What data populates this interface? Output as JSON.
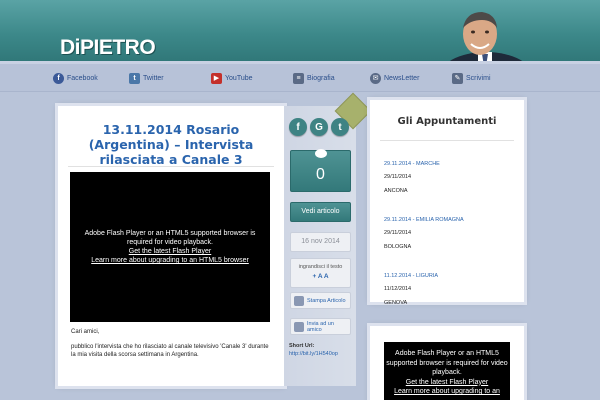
{
  "header": {
    "logo_text": "DiPIETRO"
  },
  "nav": {
    "items": [
      {
        "label": "Facebook",
        "icon": "facebook-icon",
        "color": "#3b5998"
      },
      {
        "label": "Twitter",
        "icon": "twitter-icon",
        "color": "#4a77a8"
      },
      {
        "label": "YouTube",
        "icon": "youtube-icon",
        "color": "#c4302b"
      },
      {
        "label": "Biografia",
        "icon": "biography-icon",
        "color": "#5a6a86"
      },
      {
        "label": "NewsLetter",
        "icon": "newsletter-icon",
        "color": "#5a6a86"
      },
      {
        "label": "Scrivimi",
        "icon": "pencil-icon",
        "color": "#5a6a86"
      }
    ]
  },
  "article": {
    "title": "13.11.2014 Rosario (Argentina) – Intervista rilasciata a Canale 3",
    "video": {
      "line1": "Adobe Flash Player or an HTML5 supported browser is required for video playback.",
      "link1": "Get the latest Flash Player",
      "link2": "Learn more about upgrading to an HTML5 browser"
    },
    "greeting": "Cari amici,",
    "body": "pubblico l'intervista che ho rilasciato al canale televisivo 'Canale 3' durante la mia visita della scorsa settimana in Argentina."
  },
  "tools": {
    "share": {
      "facebook": "f",
      "google": "G",
      "twitter": "t"
    },
    "comments_count": "0",
    "view_article": "Vedi articolo",
    "date": "16 nov 2014",
    "font_size_label": "ingrandisci il testo",
    "font_size_controls": "+ A A",
    "print_label": "Stampa Articolo",
    "send_label": "Invia ad un amico",
    "short_url_label": "Short Url:",
    "short_url": "http://bit.ly/1H540op"
  },
  "appointments": {
    "title": "Gli Appuntamenti",
    "items": [
      {
        "head": "29.11.2014 - MARCHE",
        "date": "29/11/2014",
        "city": "ANCONA"
      },
      {
        "head": "29.11.2014 - EMILIA ROMAGNA",
        "date": "29/11/2014",
        "city": "BOLOGNA"
      },
      {
        "head": "11.12.2014 - LIGURIA",
        "date": "11/12/2014",
        "city": "GENOVA"
      }
    ]
  },
  "video2": {
    "line1": "Adobe Flash Player or an HTML5 supported browser is required for video playback.",
    "link1": "Get the latest Flash Player",
    "link2": "Learn more about upgrading to an"
  }
}
